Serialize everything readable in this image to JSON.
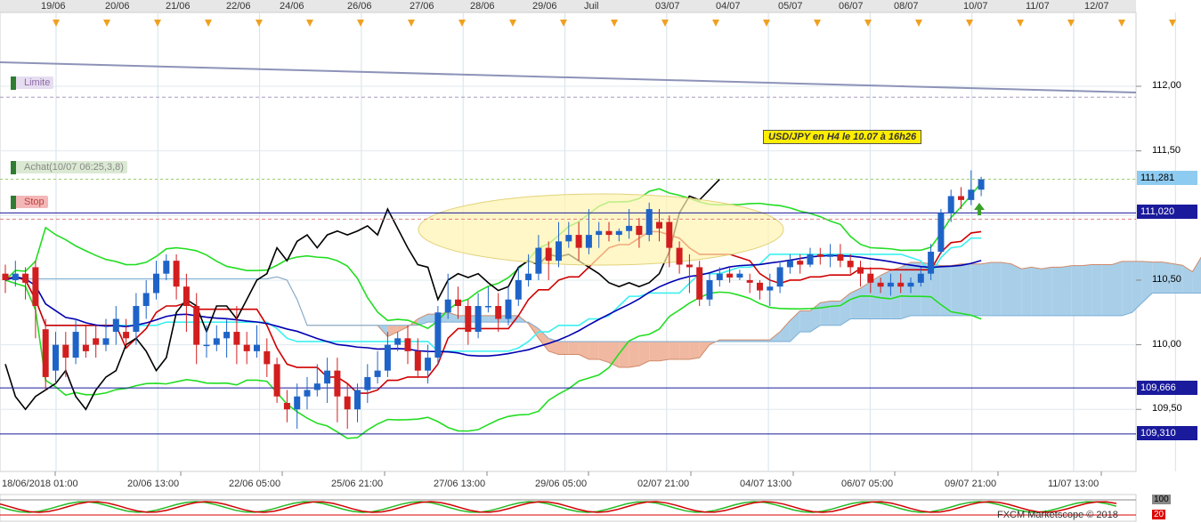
{
  "top_dates": [
    "19/06",
    "20/06",
    "21/06",
    "22/06",
    "24/06",
    "26/06",
    "27/06",
    "28/06",
    "29/06",
    "Juil",
    "03/07",
    "04/07",
    "05/07",
    "06/07",
    "08/07",
    "10/07",
    "11/07",
    "12/07"
  ],
  "bottom_dates": [
    "18/06/2018 01:00",
    "20/06 13:00",
    "22/06 05:00",
    "25/06 21:00",
    "27/06 13:00",
    "29/06 05:00",
    "02/07 21:00",
    "04/07 13:00",
    "06/07 05:00",
    "09/07 21:00",
    "11/07 13:00"
  ],
  "tags": {
    "limit": "Limite",
    "achat": "Achat(10/07 06:25,3,8)",
    "stop": "Stop"
  },
  "annotation": "USD/JPY en H4 le 10.07 à 16h26",
  "price_axis": [
    "112,00",
    "111,50",
    "110,50",
    "110,00",
    "109,50"
  ],
  "price_boxes": {
    "current": "111,281",
    "stop": "111,020",
    "s1": "109,666",
    "s2": "109,310"
  },
  "footer": "FXCM Marketscope © 2018",
  "oscillator": {
    "upper": "100",
    "lower": "20"
  },
  "colors": {
    "up": "#1e64c8",
    "down": "#d21e1e",
    "kumo_bull": "#a9cfe8",
    "kumo_bear": "#f0b8a0",
    "bollinger": "#22dd22",
    "tenkan": "#d00000",
    "kijun": "#3cf0f0",
    "ma": "#0000b0",
    "chikou": "#000000"
  },
  "chart_data": {
    "type": "candlestick",
    "title": "USD/JPY en H4 le 10.07 à 16h26",
    "yaxis": {
      "min": 109.1,
      "max": 112.3,
      "ticks": [
        112.0,
        111.5,
        110.5,
        110.0,
        109.5
      ]
    },
    "levels": {
      "limit": 111.95,
      "achat": 111.281,
      "stop": 111.02,
      "support1": 109.666,
      "support2": 109.31
    },
    "candles": [
      [
        110.55,
        110.5,
        110.62,
        110.4
      ],
      [
        110.5,
        110.55,
        110.65,
        110.45
      ],
      [
        110.55,
        110.48,
        110.6,
        110.35
      ],
      [
        110.6,
        110.3,
        110.65,
        110.05
      ],
      [
        110.12,
        109.75,
        110.2,
        109.65
      ],
      [
        109.8,
        110.0,
        110.1,
        109.7
      ],
      [
        110.0,
        109.9,
        110.1,
        109.75
      ],
      [
        109.9,
        110.1,
        110.2,
        109.85
      ],
      [
        110.0,
        109.95,
        110.15,
        109.9
      ],
      [
        110.05,
        110.0,
        110.15,
        109.9
      ],
      [
        110.0,
        110.05,
        110.2,
        109.95
      ],
      [
        110.1,
        110.2,
        110.3,
        110.0
      ],
      [
        110.1,
        110.05,
        110.2,
        110.0
      ],
      [
        110.1,
        110.3,
        110.4,
        110.0
      ],
      [
        110.3,
        110.4,
        110.5,
        110.2
      ],
      [
        110.4,
        110.55,
        110.65,
        110.35
      ],
      [
        110.55,
        110.65,
        110.7,
        110.5
      ],
      [
        110.65,
        110.45,
        110.7,
        110.35
      ],
      [
        110.45,
        110.3,
        110.55,
        110.1
      ],
      [
        110.3,
        110.0,
        110.4,
        109.85
      ],
      [
        110.0,
        110.0,
        110.15,
        109.9
      ],
      [
        110.0,
        110.05,
        110.15,
        109.95
      ],
      [
        110.05,
        110.1,
        110.2,
        109.9
      ],
      [
        110.1,
        110.0,
        110.3,
        109.85
      ],
      [
        110.0,
        109.95,
        110.1,
        109.85
      ],
      [
        109.95,
        110.0,
        110.15,
        109.9
      ],
      [
        109.95,
        109.85,
        110.05,
        109.75
      ],
      [
        109.85,
        109.6,
        109.9,
        109.55
      ],
      [
        109.55,
        109.5,
        109.65,
        109.4
      ],
      [
        109.5,
        109.6,
        109.7,
        109.35
      ],
      [
        109.6,
        109.65,
        109.75,
        109.5
      ],
      [
        109.65,
        109.7,
        109.85,
        109.6
      ],
      [
        109.7,
        109.8,
        109.9,
        109.55
      ],
      [
        109.8,
        109.6,
        109.9,
        109.4
      ],
      [
        109.6,
        109.5,
        109.7,
        109.35
      ],
      [
        109.5,
        109.65,
        109.7,
        109.4
      ],
      [
        109.65,
        109.75,
        109.85,
        109.55
      ],
      [
        109.75,
        109.8,
        109.95,
        109.7
      ],
      [
        109.8,
        110.0,
        110.1,
        109.75
      ],
      [
        110.0,
        110.05,
        110.1,
        109.95
      ],
      [
        110.05,
        109.95,
        110.15,
        109.85
      ],
      [
        109.95,
        109.8,
        110.05,
        109.75
      ],
      [
        109.8,
        109.9,
        110.0,
        109.7
      ],
      [
        109.9,
        110.25,
        110.3,
        109.85
      ],
      [
        110.25,
        110.35,
        110.55,
        110.2
      ],
      [
        110.35,
        110.3,
        110.45,
        110.2
      ],
      [
        110.3,
        110.1,
        110.35,
        110.0
      ],
      [
        110.1,
        110.3,
        110.4,
        110.05
      ],
      [
        110.3,
        110.3,
        110.45,
        110.25
      ],
      [
        110.3,
        110.2,
        110.4,
        110.1
      ],
      [
        110.2,
        110.35,
        110.45,
        110.15
      ],
      [
        110.35,
        110.5,
        110.6,
        110.3
      ],
      [
        110.5,
        110.55,
        110.7,
        110.45
      ],
      [
        110.55,
        110.75,
        110.85,
        110.5
      ],
      [
        110.75,
        110.65,
        110.8,
        110.5
      ],
      [
        110.65,
        110.8,
        110.95,
        110.6
      ],
      [
        110.8,
        110.85,
        110.95,
        110.75
      ],
      [
        110.85,
        110.75,
        110.95,
        110.65
      ],
      [
        110.75,
        110.85,
        111.05,
        110.7
      ],
      [
        110.85,
        110.88,
        110.95,
        110.75
      ],
      [
        110.88,
        110.85,
        110.95,
        110.8
      ],
      [
        110.85,
        110.88,
        110.9,
        110.8
      ],
      [
        110.88,
        110.92,
        111.05,
        110.82
      ],
      [
        110.92,
        110.85,
        110.98,
        110.75
      ],
      [
        110.85,
        111.05,
        111.1,
        110.8
      ],
      [
        110.95,
        110.9,
        111.05,
        110.8
      ],
      [
        110.95,
        110.75,
        111.0,
        110.6
      ],
      [
        110.75,
        110.62,
        110.8,
        110.55
      ],
      [
        110.62,
        110.6,
        110.7,
        110.4
      ],
      [
        110.6,
        110.35,
        110.65,
        110.3
      ],
      [
        110.35,
        110.5,
        110.55,
        110.3
      ],
      [
        110.5,
        110.55,
        110.6,
        110.45
      ],
      [
        110.55,
        110.52,
        110.6,
        110.48
      ],
      [
        110.52,
        110.55,
        110.58,
        110.5
      ],
      [
        110.5,
        110.48,
        110.55,
        110.4
      ],
      [
        110.48,
        110.42,
        110.5,
        110.35
      ],
      [
        110.42,
        110.45,
        110.55,
        110.3
      ],
      [
        110.45,
        110.6,
        110.65,
        110.4
      ],
      [
        110.6,
        110.65,
        110.7,
        110.55
      ],
      [
        110.65,
        110.62,
        110.7,
        110.55
      ],
      [
        110.62,
        110.7,
        110.75,
        110.6
      ],
      [
        110.7,
        110.68,
        110.75,
        110.62
      ],
      [
        110.68,
        110.7,
        110.78,
        110.6
      ],
      [
        110.7,
        110.65,
        110.78,
        110.6
      ],
      [
        110.65,
        110.6,
        110.7,
        110.55
      ],
      [
        110.6,
        110.55,
        110.65,
        110.45
      ],
      [
        110.55,
        110.48,
        110.6,
        110.4
      ],
      [
        110.48,
        110.45,
        110.52,
        110.4
      ],
      [
        110.45,
        110.48,
        110.55,
        110.38
      ],
      [
        110.48,
        110.45,
        110.55,
        110.4
      ],
      [
        110.45,
        110.48,
        110.52,
        110.4
      ],
      [
        110.48,
        110.55,
        110.6,
        110.45
      ],
      [
        110.55,
        110.72,
        110.78,
        110.5
      ],
      [
        110.72,
        111.02,
        111.05,
        110.7
      ],
      [
        111.02,
        111.15,
        111.2,
        110.95
      ],
      [
        111.15,
        111.12,
        111.22,
        111.05
      ],
      [
        111.12,
        111.2,
        111.35,
        111.08
      ],
      [
        111.2,
        111.28,
        111.3,
        111.15
      ]
    ]
  }
}
